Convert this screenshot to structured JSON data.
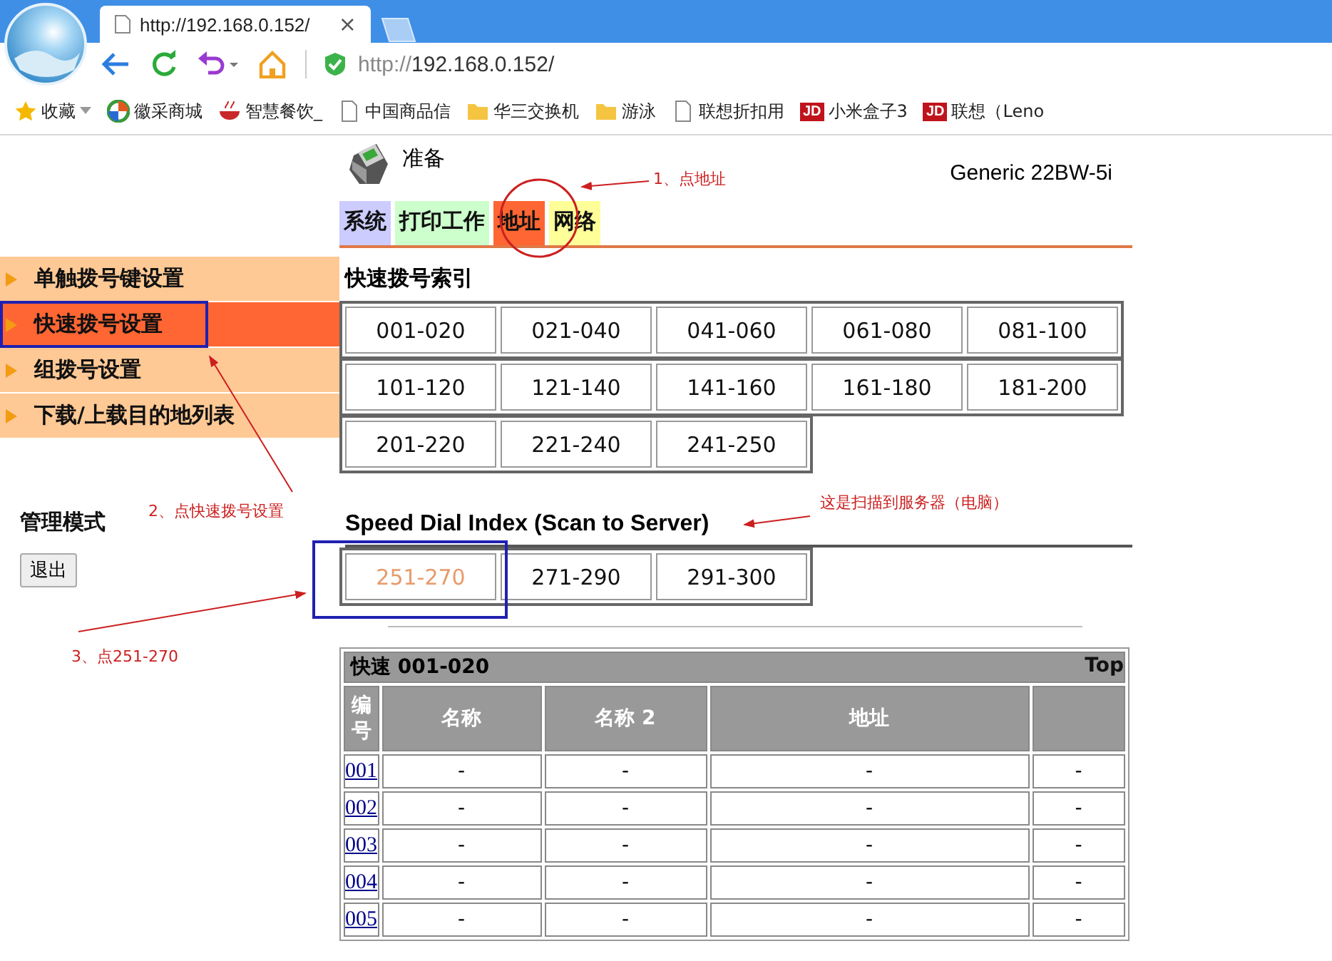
{
  "browser": {
    "tab": {
      "title": "http://192.168.0.152/",
      "close": "×"
    },
    "address": {
      "scheme": "http://",
      "host": "192.168.0.152/"
    },
    "bookmarks": [
      {
        "kind": "star",
        "label": "收藏",
        "menu": true
      },
      {
        "kind": "logo",
        "label": "徽采商城",
        "menu": false
      },
      {
        "kind": "bowl",
        "label": "智慧餐饮_",
        "menu": false
      },
      {
        "kind": "page",
        "label": "中国商品信",
        "menu": false
      },
      {
        "kind": "folder",
        "label": "华三交换机",
        "menu": false
      },
      {
        "kind": "folder",
        "label": "游泳",
        "menu": false
      },
      {
        "kind": "page",
        "label": "联想折扣用",
        "menu": false
      },
      {
        "kind": "badge",
        "badge": "JD",
        "label": "小米盒子3",
        "menu": false
      },
      {
        "kind": "badge",
        "badge": "JD",
        "label": "联想（Leno",
        "menu": false
      }
    ]
  },
  "page": {
    "status": "准备",
    "model": "Generic 22BW-5i",
    "tabs": [
      {
        "label": "系统",
        "color": "#ccccff"
      },
      {
        "label": "打印工作",
        "color": "#ccffcc"
      },
      {
        "label": "地址",
        "color": "#ff6633"
      },
      {
        "label": "网络",
        "color": "#ffff99"
      }
    ],
    "sidebar": {
      "items": [
        {
          "label": "单触拨号键设置",
          "selected": false
        },
        {
          "label": "快速拨号设置",
          "selected": true
        },
        {
          "label": "组拨号设置",
          "selected": false
        },
        {
          "label": "下载/上载目的地列表",
          "selected": false
        }
      ],
      "mode_title": "管理模式",
      "logout": "退出"
    },
    "index_heading": "快速拨号索引",
    "index_rows": [
      [
        {
          "label": "001-020",
          "visited": false
        },
        {
          "label": "021-040",
          "visited": false
        },
        {
          "label": "041-060",
          "visited": false
        },
        {
          "label": "061-080",
          "visited": false
        },
        {
          "label": "081-100",
          "visited": false
        }
      ],
      [
        {
          "label": "101-120",
          "visited": false
        },
        {
          "label": "121-140",
          "visited": false
        },
        {
          "label": "141-160",
          "visited": false
        },
        {
          "label": "161-180",
          "visited": false
        },
        {
          "label": "181-200",
          "visited": false
        }
      ],
      [
        {
          "label": "201-220",
          "visited": false
        },
        {
          "label": "221-240",
          "visited": false
        },
        {
          "label": "241-250",
          "visited": false
        }
      ]
    ],
    "scan_heading": "Speed Dial Index (Scan to Server)",
    "scan_rows": [
      [
        {
          "label": "251-270",
          "visited": true
        },
        {
          "label": "271-290",
          "visited": false
        },
        {
          "label": "291-300",
          "visited": false
        }
      ]
    ],
    "table": {
      "title": "快速 001-020",
      "top_link": "Top",
      "columns": [
        "编号",
        "名称",
        "名称 2",
        "地址"
      ],
      "rows": [
        [
          "001",
          "-",
          "-",
          "-",
          "-"
        ],
        [
          "002",
          "-",
          "-",
          "-",
          "-"
        ],
        [
          "003",
          "-",
          "-",
          "-",
          "-"
        ],
        [
          "004",
          "-",
          "-",
          "-",
          "-"
        ],
        [
          "005",
          "-",
          "-",
          "-",
          "-"
        ]
      ]
    }
  },
  "annotations": [
    {
      "text": "1、点地址"
    },
    {
      "text": "2、点快速拨号设置"
    },
    {
      "text": "3、点251-270"
    },
    {
      "text": "这是扫描到服务器（电脑）"
    }
  ]
}
